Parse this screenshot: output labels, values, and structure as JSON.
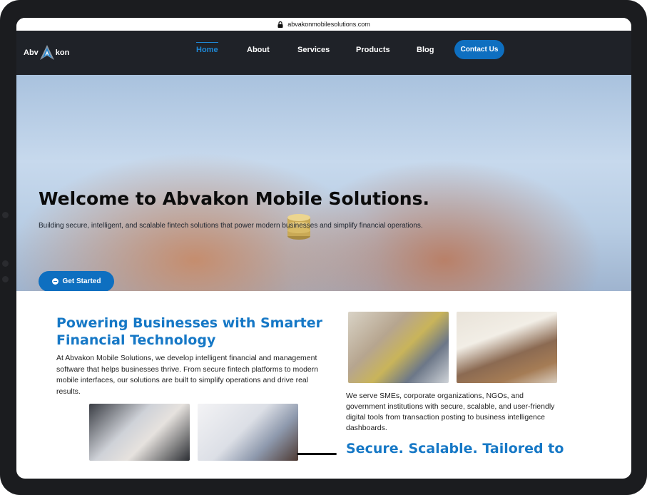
{
  "browser": {
    "url": "abvakonmobilesolutions.com"
  },
  "logo": {
    "left": "Abv",
    "right": "kon"
  },
  "nav": {
    "items": [
      "Home",
      "About",
      "Services",
      "Products",
      "Blog"
    ],
    "active": "Home",
    "contact_label": "Contact Us"
  },
  "hero": {
    "title": "Welcome to Abvakon Mobile Solutions.",
    "subtitle": "Building secure, intelligent, and scalable fintech solutions that power modern businesses and simplify financial operations.",
    "cta_label": "Get Started"
  },
  "section2": {
    "title": "Powering Businesses with Smarter Financial Technology",
    "body": "At Abvakon Mobile Solutions, we develop intelligent financial and management software that helps businesses thrive. From secure fintech platforms to modern mobile interfaces, our solutions are built to simplify operations and drive real results."
  },
  "section3": {
    "body": "We serve SMEs, corporate organizations, NGOs, and government institutions with secure, scalable, and user-friendly digital tools from transaction posting to business intelligence dashboards.",
    "title": "Secure. Scalable. Tailored to"
  },
  "colors": {
    "accent": "#1e88d6",
    "button": "#0e6fc0",
    "nav_bg": "#1f2228",
    "heading": "#1678c6"
  }
}
